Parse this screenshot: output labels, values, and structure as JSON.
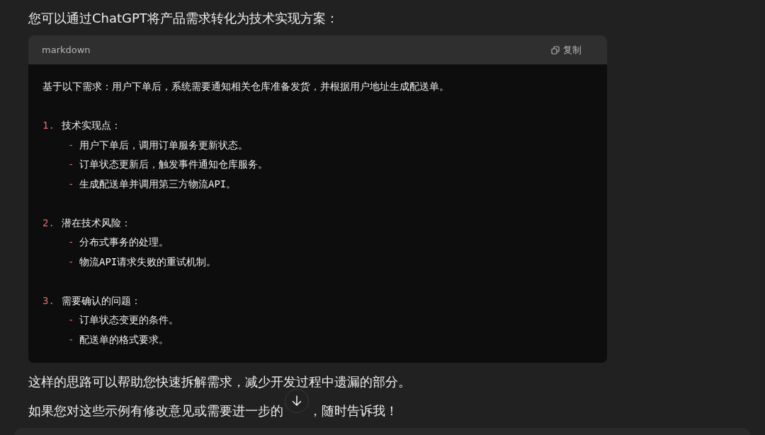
{
  "intro": "您可以通过ChatGPT将产品需求转化为技术实现方案：",
  "code_block": {
    "language": "markdown",
    "copy_label": "复制",
    "request": "基于以下需求：用户下单后，系统需要通知相关仓库准备发货，并根据用户地址生成配送单。",
    "sections": [
      {
        "number": "1.",
        "title": "技术实现点：",
        "items": [
          {
            "bullet": "-",
            "text": "用户下单后，调用订单服务更新状态。"
          },
          {
            "bullet": "-",
            "text": "订单状态更新后，触发事件通知仓库服务。"
          },
          {
            "bullet": "-",
            "text": "生成配送单并调用第三方物流API。"
          }
        ]
      },
      {
        "number": "2.",
        "title": "潜在技术风险：",
        "items": [
          {
            "bullet": "-",
            "text": "分布式事务的处理。"
          },
          {
            "bullet": "-",
            "text": "物流API请求失败的重试机制。"
          }
        ]
      },
      {
        "number": "3.",
        "title": "需要确认的问题：",
        "items": [
          {
            "bullet": "-",
            "text": "订单状态变更的条件。"
          },
          {
            "bullet": "-",
            "text": "配送单的格式要求。"
          }
        ]
      }
    ]
  },
  "summary": "这样的思路可以帮助您快速拆解需求，减少开发过程中遗漏的部分。",
  "closing": {
    "before": "如果您对这些示例有修改意见或需要进一步的",
    "after": "，随时告诉我！"
  }
}
